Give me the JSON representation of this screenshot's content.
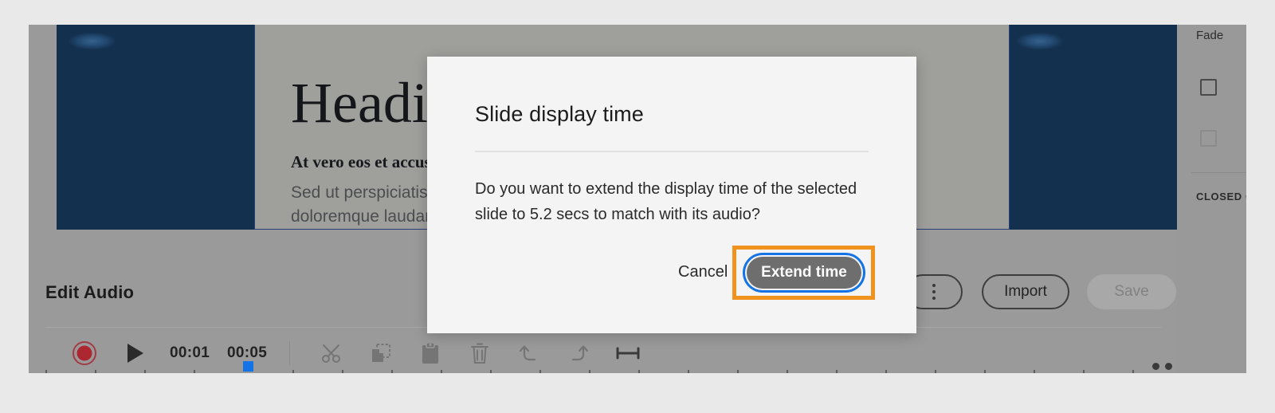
{
  "slide": {
    "heading": "Heading",
    "subheading": "At vero eos et accusamus",
    "body_line1": "Sed ut perspiciatis unde omnis iste natus error sit voluptatem",
    "body_line2": "doloremque laudantium, totam rem aperiam"
  },
  "right_sidebar": {
    "title": "Fade",
    "section_label": "CLOSED CAPTIONS"
  },
  "audio_panel": {
    "title": "Edit Audio",
    "current_time": "00:01",
    "total_time": "00:05",
    "record_icon": "record-icon",
    "play_icon": "play-icon",
    "cut_icon": "scissors-icon",
    "copy_icon": "copy-icon",
    "paste_icon": "paste-icon",
    "delete_icon": "trash-icon",
    "undo_icon": "undo-icon",
    "redo_icon": "redo-icon",
    "duration_icon": "duration-icon",
    "overflow_icon": "vertical-ellipsis-icon",
    "more_icon": "horizontal-ellipsis-icon",
    "import_label": "Import",
    "save_label": "Save"
  },
  "dialog": {
    "title": "Slide display time",
    "message": "Do you want to extend the display time of the selected slide to 5.2 secs to match with its audio?",
    "cancel_label": "Cancel",
    "confirm_label": "Extend time",
    "extend_seconds": "5.2",
    "focus_ring_color": "#1473e6",
    "annotation_color": "#f0921e",
    "confirm_bg_color": "#6e6e6e"
  }
}
